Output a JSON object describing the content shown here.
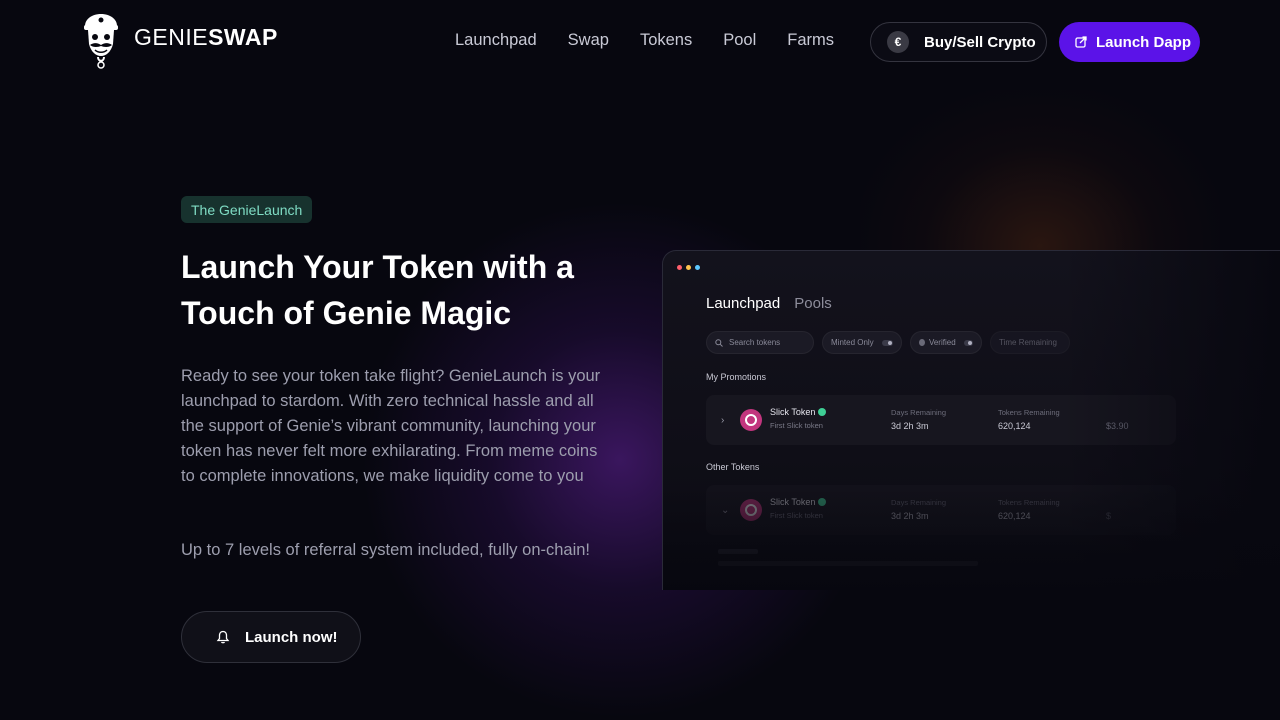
{
  "brand": {
    "name_a": "GENIE",
    "name_b": "SWAP"
  },
  "nav": [
    "Launchpad",
    "Swap",
    "Tokens",
    "Pool",
    "Farms"
  ],
  "header": {
    "buy_icon": "€",
    "buy_label": "Buy/Sell Crypto",
    "dapp_label": "Launch Dapp"
  },
  "hero": {
    "badge": "The GenieLaunch",
    "title": "Launch Your Token with a Touch of Genie Magic",
    "description": "Ready to see your token take flight? GenieLaunch is your launchpad to stardom. With zero technical hassle and all the support of Genie’s vibrant community, launching your token has never felt more exhilarating. From meme coins to complete innovations, we make liquidity come to you",
    "referral": "Up to 7 levels of referral system included, fully on-chain!",
    "cta_label": "Launch now!"
  },
  "preview": {
    "tabs": [
      "Launchpad",
      "Pools"
    ],
    "search_placeholder": "Search tokens",
    "filters": {
      "minted": "Minted Only",
      "verified": "Verified",
      "time": "Time Remaining"
    },
    "my_promotions_label": "My Promotions",
    "other_tokens_label": "Other Tokens",
    "rows": [
      {
        "chevron": "›",
        "name": "Slick Token",
        "sub": "First Slick token",
        "col1_head": "Days Remaining",
        "col1_val": "3d 2h 3m",
        "col2_head": "Tokens Remaining",
        "col2_val": "620,124",
        "col3": "$3.90"
      },
      {
        "chevron": "⌄",
        "name": "Slick Token",
        "sub": "First Slick token",
        "col1_head": "Days Remaining",
        "col1_val": "3d 2h 3m",
        "col2_head": "Tokens Remaining",
        "col2_val": "620,124",
        "col3": "$"
      }
    ]
  },
  "colors": {
    "accent": "#5b13e8",
    "badge_bg": "#17322e",
    "badge_text": "#7fdcc4",
    "background": "#07070f"
  }
}
